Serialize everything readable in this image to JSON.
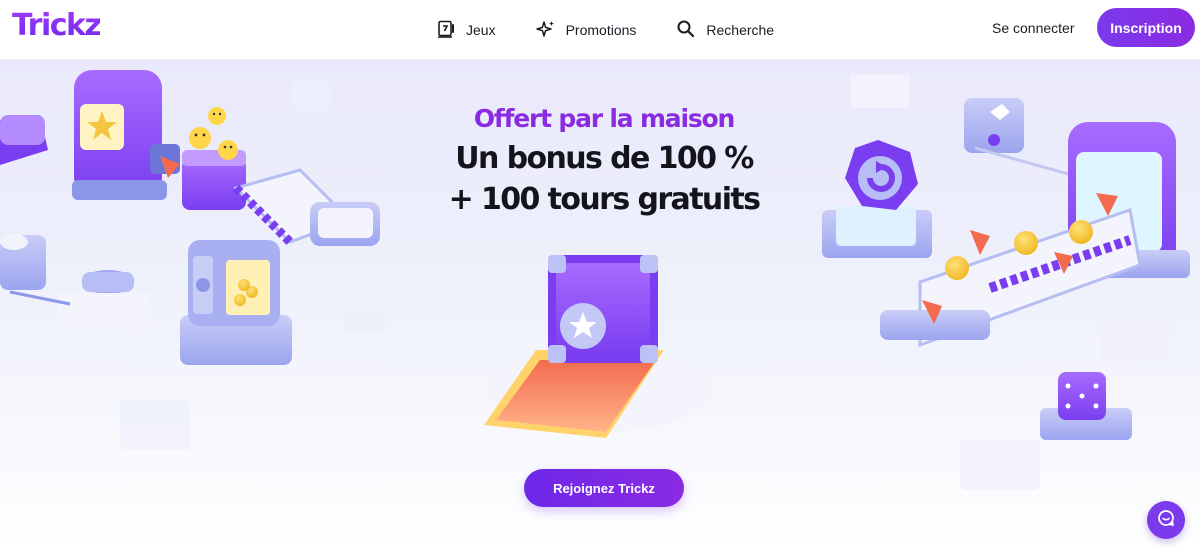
{
  "header": {
    "logo": "Trickz",
    "nav": [
      {
        "label": "Jeux",
        "icon": "games-icon"
      },
      {
        "label": "Promotions",
        "icon": "sparkle-icon"
      },
      {
        "label": "Recherche",
        "icon": "search-icon"
      }
    ],
    "login_label": "Se connecter",
    "signup_label": "Inscription"
  },
  "hero": {
    "eyebrow": "Offert par la maison",
    "headline_line1": "Un bonus de 100 %",
    "headline_line2": "+ 100 tours gratuits",
    "cta_label": "Rejoignez Trickz"
  },
  "chat": {
    "icon": "chat-icon"
  },
  "colors": {
    "brand": "#7c3aed",
    "accent": "#8a2be2",
    "coin": "#f5c542",
    "gem": "#f26b4f"
  }
}
